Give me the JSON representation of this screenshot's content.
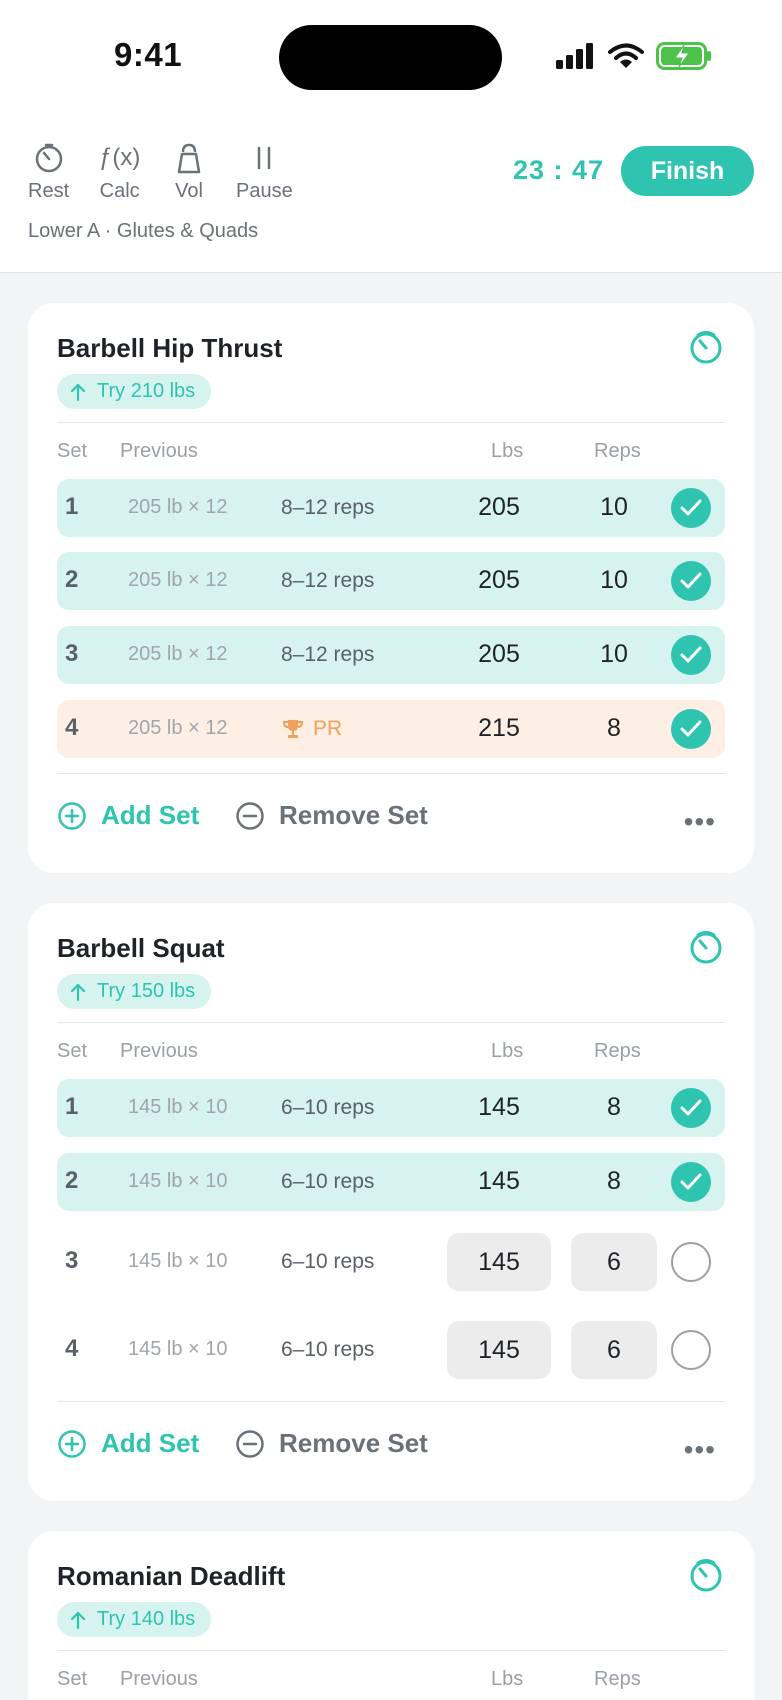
{
  "status_bar": {
    "time": "9:41"
  },
  "header": {
    "tools": [
      {
        "label": "Rest",
        "icon": "stopwatch-icon"
      },
      {
        "label": "Calc",
        "icon": "function-icon",
        "glyph": "ƒ(x)"
      },
      {
        "label": "Vol",
        "icon": "kettlebell-icon"
      },
      {
        "label": "Pause",
        "icon": "pause-icon"
      }
    ],
    "elapsed": "23 : 47",
    "finish_label": "Finish",
    "workout_name": "Lower A · Glutes & Quads"
  },
  "columns": {
    "set": "Set",
    "previous": "Previous",
    "lbs": "Lbs",
    "reps": "Reps"
  },
  "actions": {
    "add_set": "Add Set",
    "remove_set": "Remove Set",
    "more": "•••"
  },
  "exercises": [
    {
      "name": "Barbell Hip Thrust",
      "suggestion": "Try 210 lbs",
      "sets": [
        {
          "set": "1",
          "previous": "205 lb × 12",
          "target": "8–12 reps",
          "lbs": "205",
          "reps": "10",
          "status": "done"
        },
        {
          "set": "2",
          "previous": "205 lb × 12",
          "target": "8–12 reps",
          "lbs": "205",
          "reps": "10",
          "status": "done"
        },
        {
          "set": "3",
          "previous": "205 lb × 12",
          "target": "8–12 reps",
          "lbs": "205",
          "reps": "10",
          "status": "done"
        },
        {
          "set": "4",
          "previous": "205 lb × 12",
          "target": "PR",
          "lbs": "215",
          "reps": "8",
          "status": "pr"
        }
      ]
    },
    {
      "name": "Barbell Squat",
      "suggestion": "Try 150 lbs",
      "sets": [
        {
          "set": "1",
          "previous": "145 lb × 10",
          "target": "6–10 reps",
          "lbs": "145",
          "reps": "8",
          "status": "done"
        },
        {
          "set": "2",
          "previous": "145 lb × 10",
          "target": "6–10 reps",
          "lbs": "145",
          "reps": "8",
          "status": "done"
        },
        {
          "set": "3",
          "previous": "145 lb × 10",
          "target": "6–10 reps",
          "lbs": "145",
          "reps": "6",
          "status": "pending"
        },
        {
          "set": "4",
          "previous": "145 lb × 10",
          "target": "6–10 reps",
          "lbs": "145",
          "reps": "6",
          "status": "pending"
        }
      ]
    },
    {
      "name": "Romanian Deadlift",
      "suggestion": "Try 140 lbs",
      "sets": []
    }
  ],
  "colors": {
    "accent": "#2ec4b0",
    "done_row": "#d6f3ef",
    "pr_row": "#fdefe3",
    "pr_text": "#f0a05a"
  }
}
